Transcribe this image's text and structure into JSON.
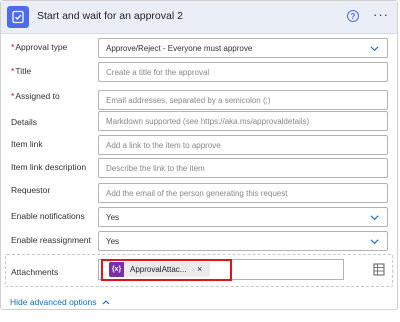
{
  "header": {
    "title": "Start and wait for an approval 2",
    "help_symbol": "?",
    "more_symbol": "···",
    "icon": "approval-icon",
    "accent": "#4f6bed"
  },
  "fields": [
    {
      "label": "Approval type",
      "required": true,
      "value": "Approve/Reject - Everyone must approve",
      "placeholder": "",
      "dropdown": true
    },
    {
      "label": "Title",
      "required": true,
      "value": "",
      "placeholder": "Create a title for the approval",
      "dropdown": false
    },
    {
      "label": "Assigned to",
      "required": true,
      "value": "",
      "placeholder": "Email addresses, separated by a semicolon (;)",
      "dropdown": false
    },
    {
      "label": "Details",
      "required": false,
      "value": "",
      "placeholder": "Markdown supported (see https://aka.ms/approvaldetails)",
      "dropdown": false
    },
    {
      "label": "Item link",
      "required": false,
      "value": "",
      "placeholder": "Add a link to the item to approve",
      "dropdown": false
    },
    {
      "label": "Item link description",
      "required": false,
      "value": "",
      "placeholder": "Describe the link to the item",
      "dropdown": false
    },
    {
      "label": "Requestor",
      "required": false,
      "value": "",
      "placeholder": "Add the email of the person generating this request",
      "dropdown": false
    },
    {
      "label": "Enable notifications",
      "required": false,
      "value": "Yes",
      "placeholder": "",
      "dropdown": true
    },
    {
      "label": "Enable reassignment",
      "required": false,
      "value": "Yes",
      "placeholder": "",
      "dropdown": true
    }
  ],
  "required_marker": "*",
  "attachments": {
    "label": "Attachments",
    "token_label": "ApprovalAttac...",
    "token_icon_text": "{x}",
    "token_remove": "×",
    "token_color": "#7a2fa8",
    "highlight_color": "#e0141e"
  },
  "footer": {
    "advanced_link": "Hide advanced options",
    "link_color": "#0f6cbd"
  }
}
